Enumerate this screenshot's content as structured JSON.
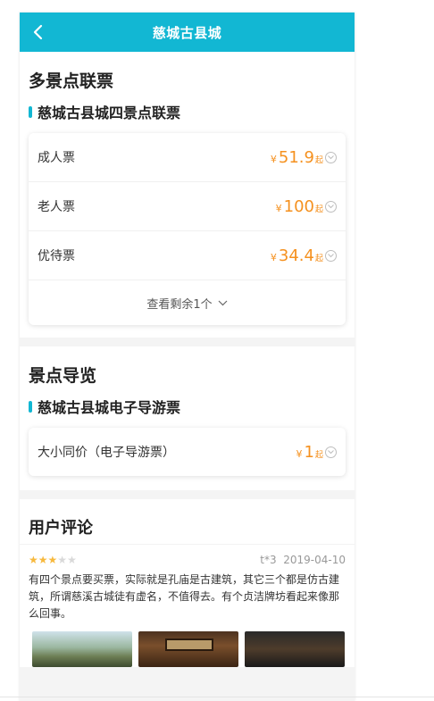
{
  "header": {
    "title": "慈城古县城"
  },
  "tickets": {
    "title": "多景点联票",
    "subtitle": "慈城古县城四景点联票",
    "items": [
      {
        "label": "成人票",
        "currency": "¥",
        "price": "51.9",
        "suffix": "起"
      },
      {
        "label": "老人票",
        "currency": "¥",
        "price": "100",
        "suffix": "起"
      },
      {
        "label": "优待票",
        "currency": "¥",
        "price": "34.4",
        "suffix": "起"
      }
    ],
    "more_label": "查看剩余1个"
  },
  "guide": {
    "title": "景点导览",
    "subtitle": "慈城古县城电子导游票",
    "items": [
      {
        "label": "大小同价（电子导游票）",
        "currency": "¥",
        "price": "1",
        "suffix": "起"
      }
    ]
  },
  "reviews": {
    "title": "用户评论",
    "items": [
      {
        "rating": 3,
        "max_rating": 5,
        "user": "t*3",
        "date": "2019-04-10",
        "text": "有四个景点要买票，实际就是孔庙是古建筑，其它三个都是仿古建筑，所谓慈溪古城徒有虚名，不值得去。有个贞洁牌坊看起来像那么回事。"
      }
    ]
  },
  "colors": {
    "accent": "#12b7d3",
    "price": "#f5911f",
    "star": "#f7b93e"
  }
}
